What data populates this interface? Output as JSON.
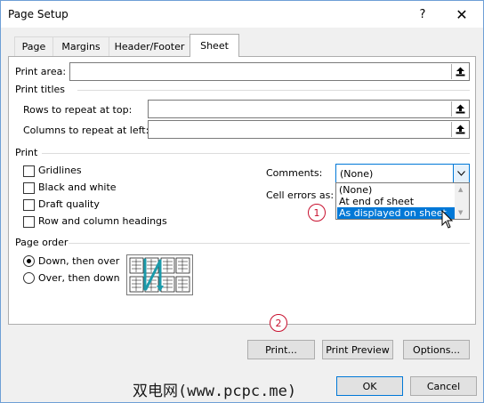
{
  "window": {
    "title": "Page Setup",
    "help": "?",
    "close": "✕"
  },
  "tabs": [
    {
      "label": "Page"
    },
    {
      "label": "Margins"
    },
    {
      "label": "Header/Footer"
    },
    {
      "label": "Sheet"
    }
  ],
  "print_area": {
    "label": "Print area:",
    "value": ""
  },
  "print_titles": {
    "heading": "Print titles",
    "rows_label": "Rows to repeat at top:",
    "rows_value": "",
    "cols_label": "Columns to repeat at left:",
    "cols_value": ""
  },
  "print": {
    "heading": "Print",
    "gridlines": {
      "label": "Gridlines",
      "checked": false
    },
    "black_white": {
      "label": "Black and white",
      "checked": false
    },
    "draft": {
      "label": "Draft quality",
      "checked": false
    },
    "headings": {
      "label": "Row and column headings",
      "checked": false
    },
    "comments_label": "Comments:",
    "comments_value": "(None)",
    "comments_options": [
      "(None)",
      "At end of sheet",
      "As displayed on sheet"
    ],
    "cell_errors_label": "Cell errors as:"
  },
  "page_order": {
    "heading": "Page order",
    "down_then_over": "Down, then over",
    "over_then_down": "Over, then down",
    "selected": "down_then_over"
  },
  "buttons": {
    "print": "Print...",
    "print_preview": "Print Preview",
    "options": "Options...",
    "ok": "OK",
    "cancel": "Cancel"
  },
  "callouts": [
    "1",
    "2"
  ],
  "watermark": "双电网(www.pcpc.me)",
  "colors": {
    "accent": "#0078d7",
    "callout": "#c8102e",
    "preview_arrow": "#1b9aaa"
  },
  "icons": [
    "collapse-dialog-icon",
    "chevron-down-icon",
    "page-order-preview-icon",
    "mouse-cursor-icon"
  ]
}
